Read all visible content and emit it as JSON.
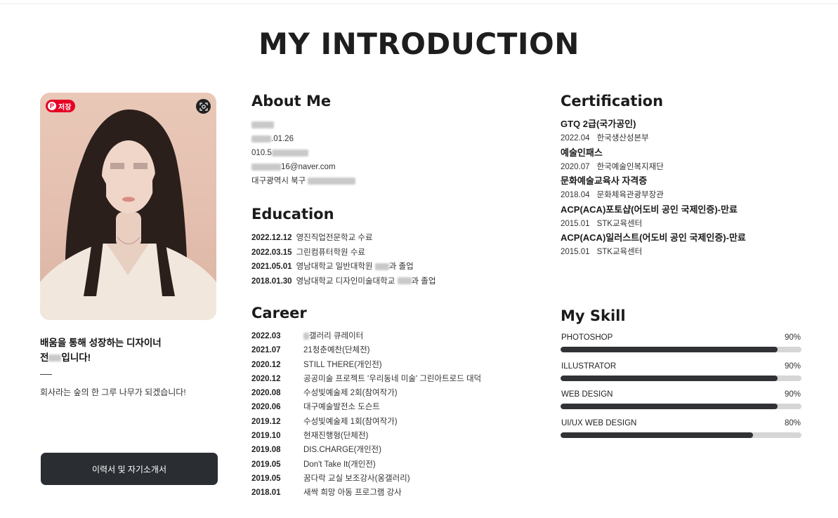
{
  "page": {
    "title": "MY INTRODUCTION"
  },
  "profile": {
    "pin_label": "저장",
    "tagline_line1": "배움을 통해 성장하는 디자이너",
    "tagline_line2_prefix": "전",
    "tagline_line2_suffix": "입니다!",
    "motto": "회사라는 숲의 한 그루 나무가 되겠습니다!",
    "resume_button": "이력서 및 자기소개서"
  },
  "about": {
    "title": "About Me",
    "birth_suffix": ".01.26",
    "phone_prefix": "010.5",
    "email_suffix": "16@naver.com",
    "address_prefix": "대구광역시 북구"
  },
  "education": {
    "title": "Education",
    "items": [
      {
        "date": "2022.12.12",
        "text": "영진직업전문학교 수료"
      },
      {
        "date": "2022.03.15",
        "text": "그린컴퓨터학원 수료"
      },
      {
        "date": "2021.05.01",
        "text": "영남대학교 일반대학원",
        "suffix": "과 졸업"
      },
      {
        "date": "2018.01.30",
        "text": "영남대학교 디자인미술대학교",
        "suffix": "과 졸업"
      }
    ]
  },
  "career": {
    "title": "Career",
    "items": [
      {
        "date": "2022.03",
        "text": "갤러리 큐레이터"
      },
      {
        "date": "2021.07",
        "text": "21청춘예찬(단체전)"
      },
      {
        "date": "2020.12",
        "text": "STILL THERE(개인전)"
      },
      {
        "date": "2020.12",
        "text": "공공미술 프로젝트 '우리동네 미술' 그린아트로드 대덕"
      },
      {
        "date": "2020.08",
        "text": "수성빛예술제 2회(참여작가)"
      },
      {
        "date": "2020.06",
        "text": "대구예술발전소 도슨트"
      },
      {
        "date": "2019.12",
        "text": "수성빛예술제 1회(참여작가)"
      },
      {
        "date": "2019.10",
        "text": "현재진행형(단체전)"
      },
      {
        "date": "2019.08",
        "text": "DIS.CHARGE(개인전)"
      },
      {
        "date": "2019.05",
        "text": "Don't Take It(개인전)"
      },
      {
        "date": "2019.05",
        "text": "꿈다락 교실 보조강사(옹갤러리)"
      },
      {
        "date": "2018.01",
        "text": "새싹 희망 아동 프로그램 강사"
      }
    ]
  },
  "certification": {
    "title": "Certification",
    "items": [
      {
        "name": "GTQ 2급(국가공인)",
        "date": "2022.04",
        "issuer": "한국생산성본부"
      },
      {
        "name": "예술인패스",
        "date": "2020.07",
        "issuer": "한국예술인복지재단"
      },
      {
        "name": "문화예술교육사 자격증",
        "date": "2018.04",
        "issuer": "문화체육관광부장관"
      },
      {
        "name": "ACP(ACA)포토샵(어도비 공인 국제인증)-만료",
        "date": "2015.01",
        "issuer": "STK교육센터"
      },
      {
        "name": "ACP(ACA)일러스트(어도비 공인 국제인증)-만료",
        "date": "2015.01",
        "issuer": "STK교육센터"
      }
    ]
  },
  "skills": {
    "title": "My Skill",
    "items": [
      {
        "name": "PHOTOSHOP",
        "percent_label": "90%",
        "level": 0.9
      },
      {
        "name": "ILLUSTRATOR",
        "percent_label": "90%",
        "level": 0.9
      },
      {
        "name": "WEB DESIGN",
        "percent_label": "90%",
        "level": 0.9
      },
      {
        "name": "UI/UX WEB DESIGN",
        "percent_label": "80%",
        "level": 0.8
      }
    ]
  },
  "colors": {
    "pin_red": "#e60023",
    "button_dark": "#2a2e33",
    "bar_fill": "#303235",
    "bar_track": "#d6d6d6"
  },
  "icons": {
    "pin": "pinterest-icon",
    "lens": "visual-search-icon"
  }
}
